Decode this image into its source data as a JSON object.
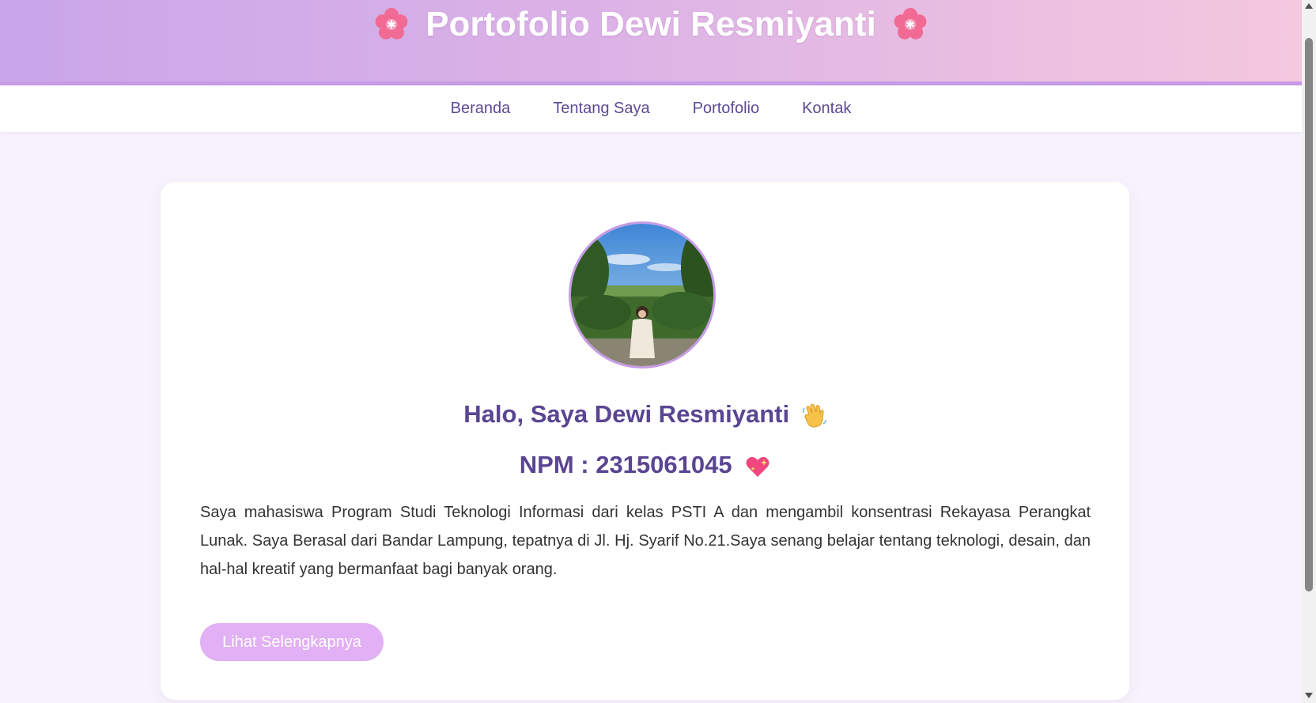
{
  "header": {
    "title": "Portofolio Dewi Resmiyanti",
    "decoration_icon": "cherry-blossom-icon"
  },
  "nav": {
    "items": [
      {
        "label": "Beranda"
      },
      {
        "label": "Tentang Saya"
      },
      {
        "label": "Portofolio"
      },
      {
        "label": "Kontak"
      }
    ]
  },
  "profile": {
    "greeting": "Halo, Saya Dewi Resmiyanti",
    "greeting_icon": "waving-hand-icon",
    "npm": "NPM : 2315061045",
    "npm_icon": "sparkling-heart-icon",
    "bio": "Saya mahasiswa Program Studi Teknologi Informasi dari kelas PSTI A dan mengambil konsentrasi Rekayasa Perangkat Lunak. Saya Berasal dari Bandar Lampung, tepatnya di Jl. Hj. Syarif No.21.Saya senang belajar tentang teknologi, desain, dan hal-hal kreatif yang bermanfaat bagi banyak orang.",
    "cta_label": "Lihat Selengkapnya"
  },
  "colors": {
    "accent": "#c79be6",
    "heading": "#5a4592",
    "button": "#e2b0f4"
  }
}
